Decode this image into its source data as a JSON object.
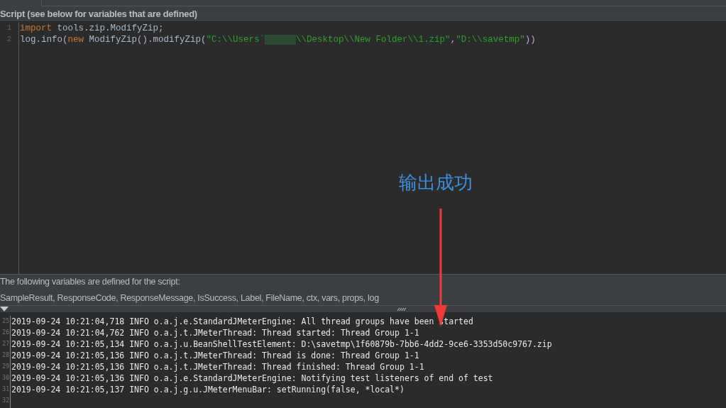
{
  "script_panel": {
    "title": "Script (see below for variables that are defined)",
    "lines": [
      {
        "number": "1",
        "tokens": [
          {
            "kind": "keyword",
            "text": "import"
          },
          {
            "kind": "plain",
            "text": " tools.zip.ModifyZip;"
          }
        ]
      },
      {
        "number": "2",
        "tokens": [
          {
            "kind": "plain",
            "text": "log.info("
          },
          {
            "kind": "keyword",
            "text": "new"
          },
          {
            "kind": "plain",
            "text": " ModifyZip().modifyZip("
          },
          {
            "kind": "string",
            "text": "\"C:\\\\Users`"
          },
          {
            "kind": "redacted"
          },
          {
            "kind": "string",
            "text": "\\\\Desktop\\\\New Folder\\\\1.zip\""
          },
          {
            "kind": "plain",
            "text": ","
          },
          {
            "kind": "string",
            "text": "\"D:\\\\savetmp\""
          },
          {
            "kind": "plain",
            "text": "))"
          }
        ]
      }
    ]
  },
  "annotation": {
    "text": "输出成功"
  },
  "variables": {
    "heading": "The following variables are defined for the script:",
    "list": "SampleResult, ResponseCode, ResponseMessage, IsSuccess, Label, FileName, ctx, vars, props, log"
  },
  "log": {
    "lines": [
      {
        "number": "25",
        "text": "2019-09-24 10:21:04,718 INFO o.a.j.e.StandardJMeterEngine: All thread groups have been started"
      },
      {
        "number": "26",
        "text": "2019-09-24 10:21:04,762 INFO o.a.j.t.JMeterThread: Thread started: Thread Group 1-1"
      },
      {
        "number": "27",
        "text": "2019-09-24 10:21:05,134 INFO o.a.j.u.BeanShellTestElement: D:\\savetmp\\1f60879b-7bb6-4dd2-9ce6-3353d50c9767.zip"
      },
      {
        "number": "28",
        "text": "2019-09-24 10:21:05,136 INFO o.a.j.t.JMeterThread: Thread is done: Thread Group 1-1"
      },
      {
        "number": "29",
        "text": "2019-09-24 10:21:05,136 INFO o.a.j.t.JMeterThread: Thread finished: Thread Group 1-1"
      },
      {
        "number": "30",
        "text": "2019-09-24 10:21:05,136 INFO o.a.j.e.StandardJMeterEngine: Notifying test listeners of end of test"
      },
      {
        "number": "31",
        "text": "2019-09-24 10:21:05,137 INFO o.a.j.g.u.JMeterMenuBar: setRunning(false, *local*)"
      },
      {
        "number": "32"
      }
    ]
  }
}
